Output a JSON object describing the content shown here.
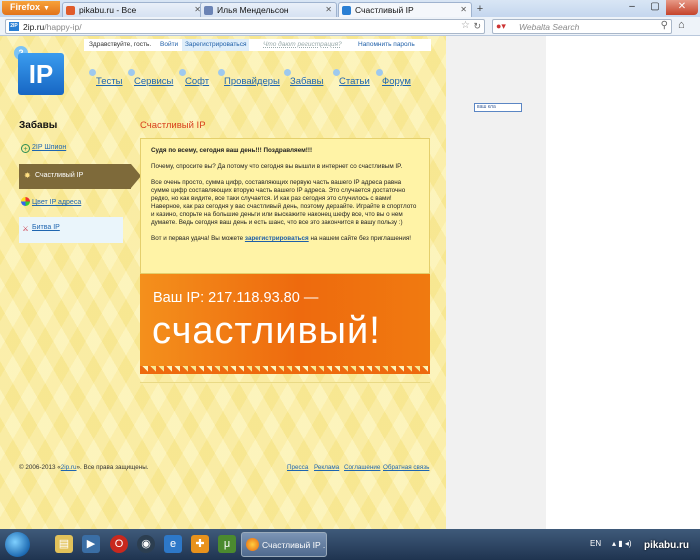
{
  "browser": {
    "menu_label": "Firefox",
    "tabs": [
      {
        "title": "pikabu.ru - Все",
        "favicon_color": "#e05b2a",
        "active": false
      },
      {
        "title": "Илья Мендельсон",
        "favicon_color": "#6b83b5",
        "active": false
      },
      {
        "title": "Счастливый IP",
        "favicon_color": "#2a7fd4",
        "active": true
      }
    ],
    "new_tab_label": "+",
    "url_host": "2ip.ru",
    "url_path": "/happy-ip/",
    "search_placeholder": "Webalta Search",
    "window_controls": [
      "–",
      "▢",
      "✕"
    ]
  },
  "site": {
    "logo_text": "IP",
    "logo_badge": "2",
    "topbar": {
      "greeting": "Здравствуйте, гость.",
      "login": "Войти",
      "register": "Зарегистрироваться",
      "hint": "Что дают регистрация?",
      "forgot": "Напомнить пароль"
    },
    "nav": [
      "Тесты",
      "Сервисы",
      "Софт",
      "Провайдеры",
      "Забавы",
      "Статьи",
      "Форум"
    ],
    "sidebar": {
      "title": "Забавы",
      "items": [
        "2IP Шпион",
        "Счастливый IP",
        "Цвет IP адреса",
        "Битва IP"
      ]
    },
    "content": {
      "title": "Счастливый IP",
      "headline": "Судя по всему, сегодня ваш день!!! Поздравляем!!!",
      "p1": "Почему, спросите вы? Да потому что сегодня вы вышли в интернет со счастливым IP.",
      "p2": "Все очень просто, сумма цифр, составляющих первую часть вашего IP адреса равна сумме цифр составляющих вторую часть вашего IP адреса. Это случается достаточно редко, но как видите, все таки случается. И как раз сегодня это случилось с вами! Наверное, как раз сегодня у вас счастливый день, поэтому дерзайте. Играйте в спортлото и казино, спорьте на большие деньги или выскажите наконец шефу все, что вы о нем думаете. Ведь сегодня ваш день и есть шанс, что все это закончится в вашу пользу :)",
      "p3_before": "Вот и первая удача! Вы можете",
      "p3_link": "зарегистрироваться",
      "p3_after": "на нашем сайте без приглашения!"
    },
    "banner": {
      "ip_line": "Ваш IP: 217.118.93.80 —",
      "lucky": "счастливый!"
    },
    "footer": {
      "copyright_before": "© 2006-2013 «",
      "copyright_link": "2ip.ru",
      "copyright_after": "». Все права защищены.",
      "links": [
        "Пресса",
        "Реклама",
        "Соглашение",
        "Обратная связь"
      ]
    },
    "ad_label": "ваш кла"
  },
  "taskbar": {
    "task_label": "Счастливый IP ...",
    "lang": "EN",
    "watermark": "pikabu.ru"
  }
}
